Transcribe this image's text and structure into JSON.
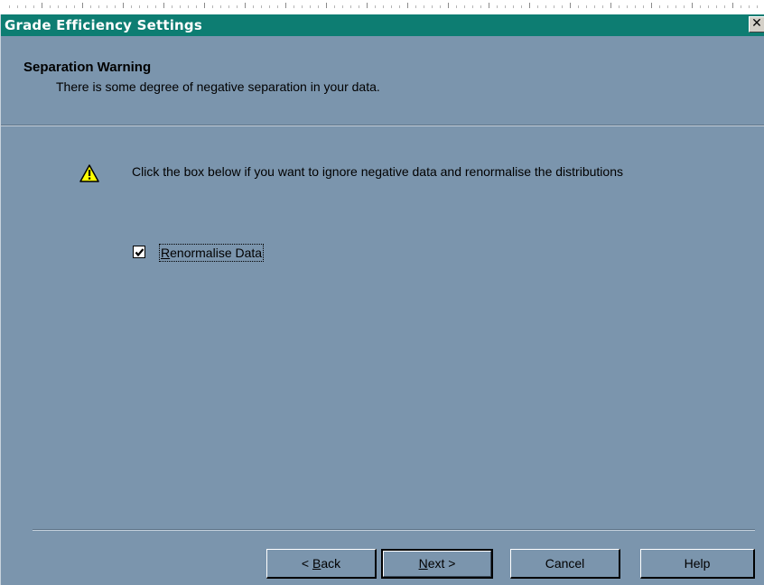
{
  "window": {
    "title": "Grade Efficiency Settings",
    "close_glyph": "✕"
  },
  "header": {
    "title": "Separation Warning",
    "subtitle": "There is some degree of negative separation in your data."
  },
  "warning": {
    "icon": "warning-icon",
    "message": "Click the box below if you want to ignore negative data and renormalise the distributions"
  },
  "option": {
    "label_first": "R",
    "label_rest": "enormalise Data",
    "checked": true
  },
  "buttons": {
    "back_prefix": "< ",
    "back_mnemonic": "B",
    "back_rest": "ack",
    "next_mnemonic": "N",
    "next_rest": "ext >",
    "cancel": "Cancel",
    "help": "Help"
  },
  "colors": {
    "titlebar": "#0d7d72",
    "dialog_bg": "#7b95ad",
    "warning_yellow": "#ffff00"
  }
}
